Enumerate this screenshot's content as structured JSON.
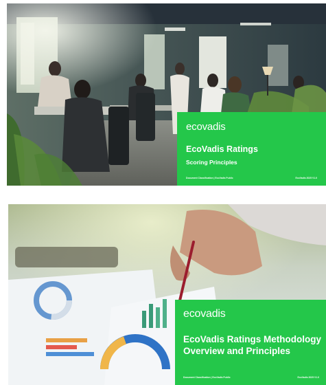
{
  "cards": [
    {
      "brand": "ecovadis",
      "title": "EcoVadis Ratings",
      "subtitle": "Scoring Principles",
      "footer_left": "Document Classification | EcoVadis Public",
      "footer_right": "EcoVadis 2025 V1.0"
    },
    {
      "brand": "ecovadis",
      "title": "EcoVadis Ratings Methodology Overview and Principles",
      "footer_left": "Document Classification | EcoVadis Public",
      "footer_right": "EcoVadis 2025 V1.0"
    }
  ],
  "colors": {
    "panel_green": "#24c74a",
    "panel_text": "#ffffff"
  }
}
